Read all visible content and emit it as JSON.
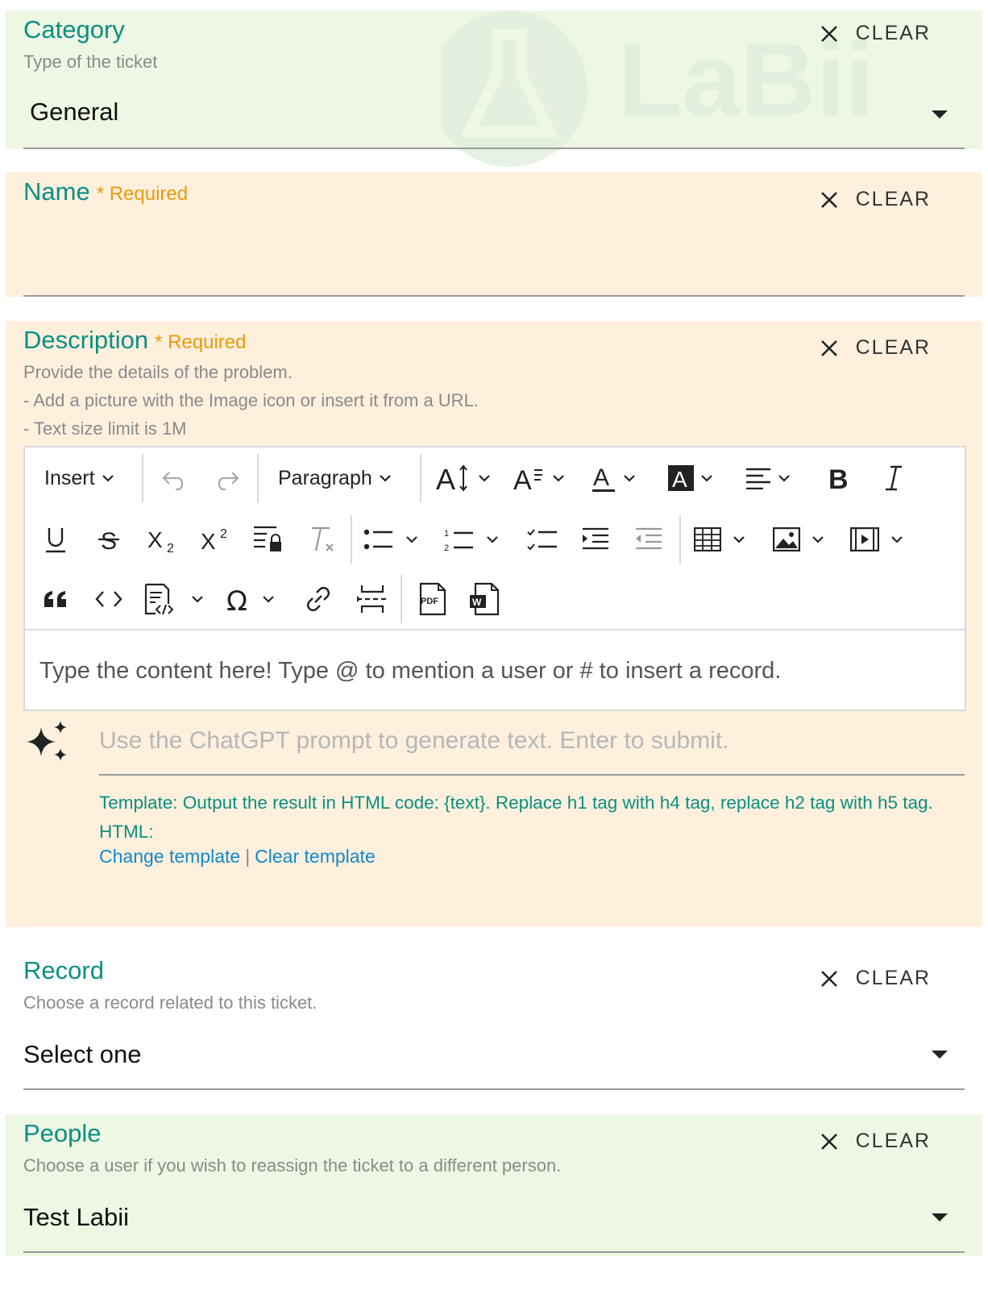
{
  "category": {
    "label": "Category",
    "hint": "Type of the ticket",
    "value": "General",
    "clear": "CLEAR"
  },
  "watermark": {
    "text": "LaBii"
  },
  "name": {
    "label": "Name",
    "required": "* Required",
    "clear": "CLEAR",
    "value": ""
  },
  "description": {
    "label": "Description",
    "required": "* Required",
    "clear": "CLEAR",
    "hints": [
      "Provide the details of the problem.",
      "- Add a picture with the Image icon or insert it from a URL.",
      "- Text size limit is 1M"
    ],
    "toolbar": {
      "insert": "Insert",
      "paragraph": "Paragraph"
    },
    "editor_placeholder": "Type the content here! Type @ to mention a user or # to insert a record.",
    "gpt_placeholder": "Use the ChatGPT prompt to generate text. Enter to submit.",
    "template": "Template: Output the result in HTML code: {text}. Replace h1 tag with h4 tag, replace h2 tag with h5 tag. HTML:",
    "change_template": "Change template",
    "clear_template": "Clear template",
    "links_separator": "|"
  },
  "record": {
    "label": "Record",
    "hint": "Choose a record related to this ticket.",
    "value": "Select one",
    "clear": "CLEAR"
  },
  "people": {
    "label": "People",
    "hint": "Choose a user if you wish to reassign the ticket to a different person.",
    "value": "Test Labii",
    "clear": "CLEAR"
  },
  "colors": {
    "label": "#0a9080",
    "required": "#e99a0c",
    "link": "#1389c9",
    "green_bg": "#eef7e4",
    "peach_bg": "#fff0de"
  }
}
